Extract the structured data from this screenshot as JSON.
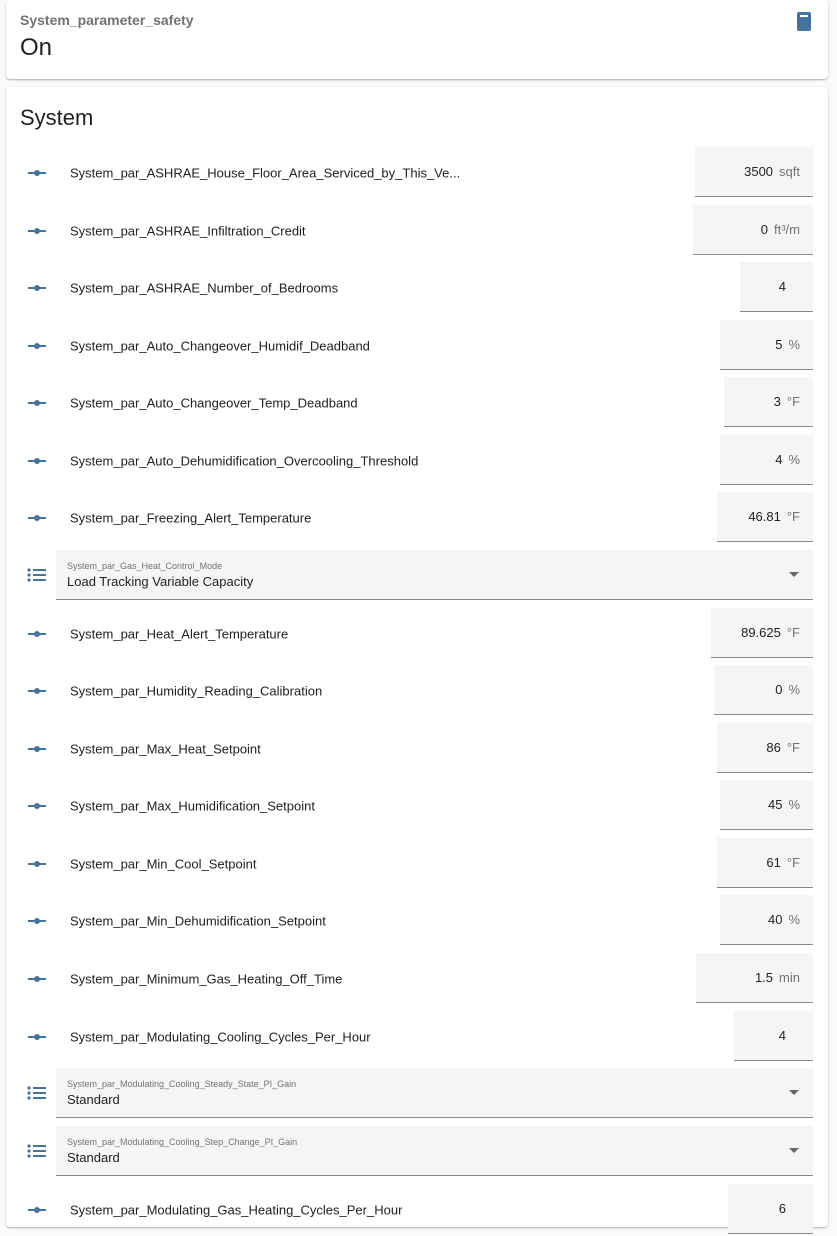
{
  "header_card": {
    "label": "System_parameter_safety",
    "state": "On",
    "icon": "door-closed-icon"
  },
  "system_card": {
    "title": "System",
    "numbers": [
      {
        "label": "System_par_ASHRAE_House_Floor_Area_Serviced_by_This_Ve...",
        "value": "3500",
        "unit": "sqft"
      },
      {
        "label": "System_par_ASHRAE_Infiltration_Credit",
        "value": "0",
        "unit": "ft³/m"
      },
      {
        "label": "System_par_ASHRAE_Number_of_Bedrooms",
        "value": "4",
        "unit": ""
      },
      {
        "label": "System_par_Auto_Changeover_Humidif_Deadband",
        "value": "5",
        "unit": "%"
      },
      {
        "label": "System_par_Auto_Changeover_Temp_Deadband",
        "value": "3",
        "unit": "°F"
      },
      {
        "label": "System_par_Auto_Dehumidification_Overcooling_Threshold",
        "value": "4",
        "unit": "%"
      },
      {
        "label": "System_par_Freezing_Alert_Temperature",
        "value": "46.81",
        "unit": "°F"
      },
      {
        "label": "System_par_Heat_Alert_Temperature",
        "value": "89.625",
        "unit": "°F"
      },
      {
        "label": "System_par_Humidity_Reading_Calibration",
        "value": "0",
        "unit": "%"
      },
      {
        "label": "System_par_Max_Heat_Setpoint",
        "value": "86",
        "unit": "°F"
      },
      {
        "label": "System_par_Max_Humidification_Setpoint",
        "value": "45",
        "unit": "%"
      },
      {
        "label": "System_par_Min_Cool_Setpoint",
        "value": "61",
        "unit": "°F"
      },
      {
        "label": "System_par_Min_Dehumidification_Setpoint",
        "value": "40",
        "unit": "%"
      },
      {
        "label": "System_par_Minimum_Gas_Heating_Off_Time",
        "value": "1.5",
        "unit": "min"
      },
      {
        "label": "System_par_Modulating_Cooling_Cycles_Per_Hour",
        "value": "4",
        "unit": ""
      },
      {
        "label": "System_par_Modulating_Gas_Heating_Cycles_Per_Hour",
        "value": "6",
        "unit": ""
      }
    ],
    "selects": [
      {
        "label": "System_par_Gas_Heat_Control_Mode",
        "value": "Load Tracking Variable Capacity"
      },
      {
        "label": "System_par_Modulating_Cooling_Steady_State_PI_Gain",
        "value": "Standard"
      },
      {
        "label": "System_par_Modulating_Cooling_Step_Change_PI_Gain",
        "value": "Standard"
      }
    ]
  },
  "colors": {
    "icon": "#44739e",
    "field_bg": "#f5f5f5",
    "underline": "#8a8a8a",
    "secondary_text": "#727272"
  }
}
